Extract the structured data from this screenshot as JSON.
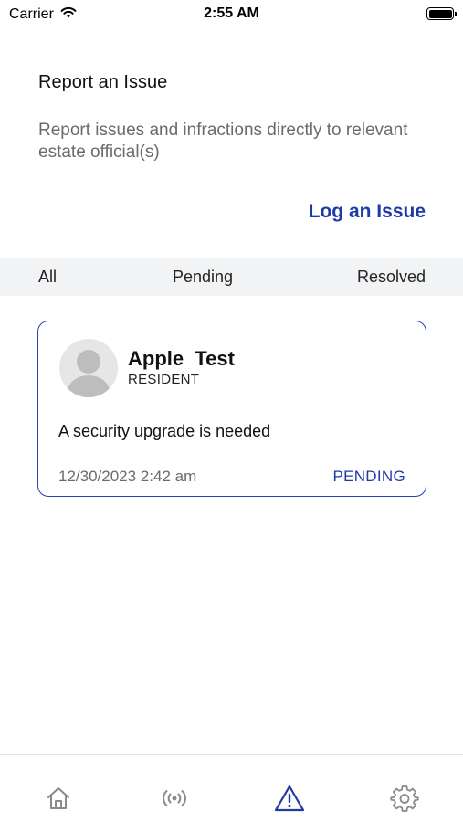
{
  "status_bar": {
    "carrier": "Carrier",
    "time": "2:55 AM",
    "icons": [
      "wifi-icon",
      "battery-icon"
    ]
  },
  "header": {
    "title": "Report an Issue",
    "description": "Report issues and infractions directly to relevant estate official(s)",
    "action_label": "Log an Issue"
  },
  "tabs": [
    {
      "label": "All"
    },
    {
      "label": "Pending"
    },
    {
      "label": "Resolved"
    }
  ],
  "issues": [
    {
      "name": "Apple  Test",
      "role": "RESIDENT",
      "text": "A security upgrade is needed",
      "date": "12/30/2023 2:42 am",
      "status": "PENDING"
    }
  ],
  "bottom_nav": [
    {
      "icon": "home-icon",
      "active": false
    },
    {
      "icon": "broadcast-icon",
      "active": false
    },
    {
      "icon": "warning-icon",
      "active": true
    },
    {
      "icon": "gear-icon",
      "active": false
    }
  ],
  "colors": {
    "accent": "#1e3aa8",
    "card_border": "#2a3fb0",
    "muted_text": "#6b6b6b",
    "tab_bar_bg": "#f2f3f5",
    "icon_inactive": "#8a8a8a"
  }
}
